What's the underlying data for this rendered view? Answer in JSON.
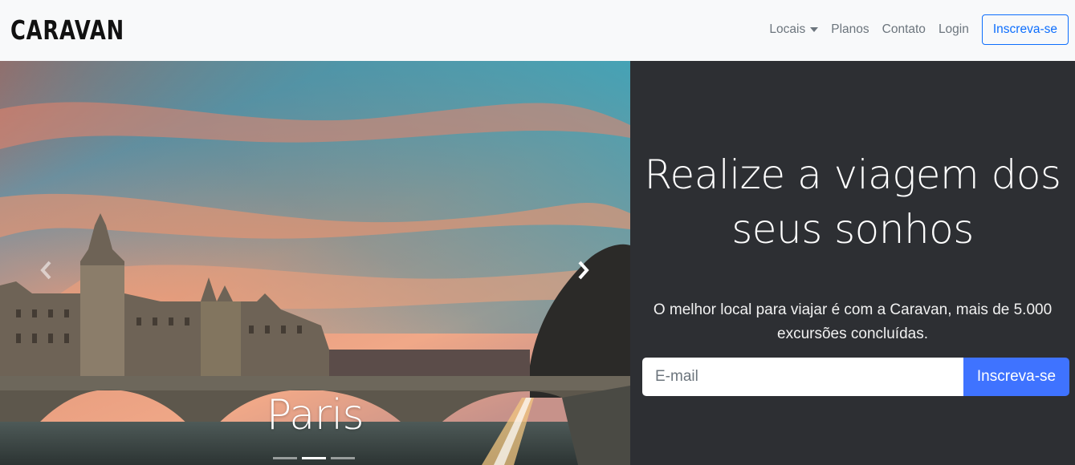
{
  "navbar": {
    "brand": "CARAVAN",
    "links": [
      {
        "label": "Locais",
        "dropdown": true
      },
      {
        "label": "Planos"
      },
      {
        "label": "Contato"
      },
      {
        "label": "Login"
      }
    ],
    "signup_label": "Inscreva-se"
  },
  "carousel": {
    "caption": "Paris",
    "slide_count": 3,
    "active_index": 1,
    "prev_icon": "chevron-left-icon",
    "next_icon": "chevron-right-icon"
  },
  "hero": {
    "headline_line1": "Realize a viagem dos",
    "headline_line2": "seus sonhos",
    "lead_line1": "O melhor local para viajar é com a Caravan, mais de 5.000",
    "lead_line2": "excursões concluídas.",
    "email_placeholder": "E-mail",
    "submit_label": "Inscreva-se"
  },
  "colors": {
    "navbar_bg": "#f8f9fa",
    "panel_bg": "#2d2f33",
    "primary": "#3f73ff",
    "outline": "#0d6efd"
  }
}
